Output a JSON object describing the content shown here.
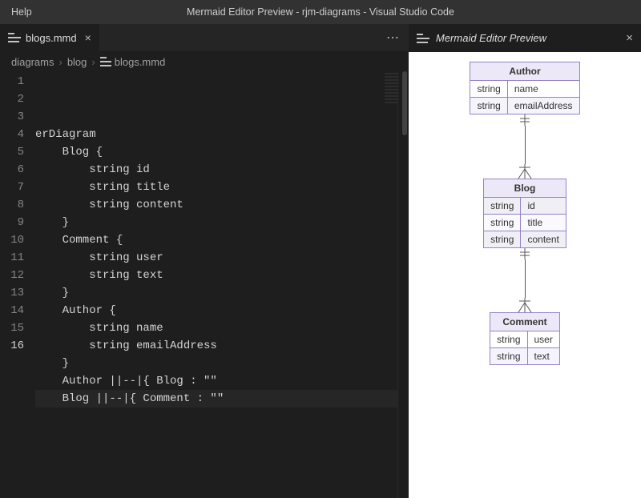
{
  "menubar": {
    "help": "Help"
  },
  "window_title": "Mermaid Editor Preview - rjm-diagrams - Visual Studio Code",
  "editor": {
    "tab_label": "blogs.mmd",
    "breadcrumbs": {
      "folder1": "diagrams",
      "folder2": "blog",
      "file": "blogs.mmd"
    },
    "line_numbers": [
      "1",
      "2",
      "3",
      "4",
      "5",
      "6",
      "7",
      "8",
      "9",
      "10",
      "11",
      "12",
      "13",
      "14",
      "15",
      "16"
    ],
    "current_line": 16,
    "code_lines": [
      "erDiagram",
      "    Blog {",
      "        string id",
      "        string title",
      "        string content",
      "    }",
      "    Comment {",
      "        string user",
      "        string text",
      "    }",
      "    Author {",
      "        string name",
      "        string emailAddress",
      "    }",
      "    Author ||--|{ Blog : \"\"",
      "    Blog ||--|{ Comment : \"\""
    ]
  },
  "preview": {
    "tab_label": "Mermaid Editor Preview",
    "entities": {
      "author": {
        "title": "Author",
        "rows": [
          [
            "string",
            "name"
          ],
          [
            "string",
            "emailAddress"
          ]
        ]
      },
      "blog": {
        "title": "Blog",
        "rows": [
          [
            "string",
            "id"
          ],
          [
            "string",
            "title"
          ],
          [
            "string",
            "content"
          ]
        ]
      },
      "comment": {
        "title": "Comment",
        "rows": [
          [
            "string",
            "user"
          ],
          [
            "string",
            "text"
          ]
        ]
      }
    }
  }
}
